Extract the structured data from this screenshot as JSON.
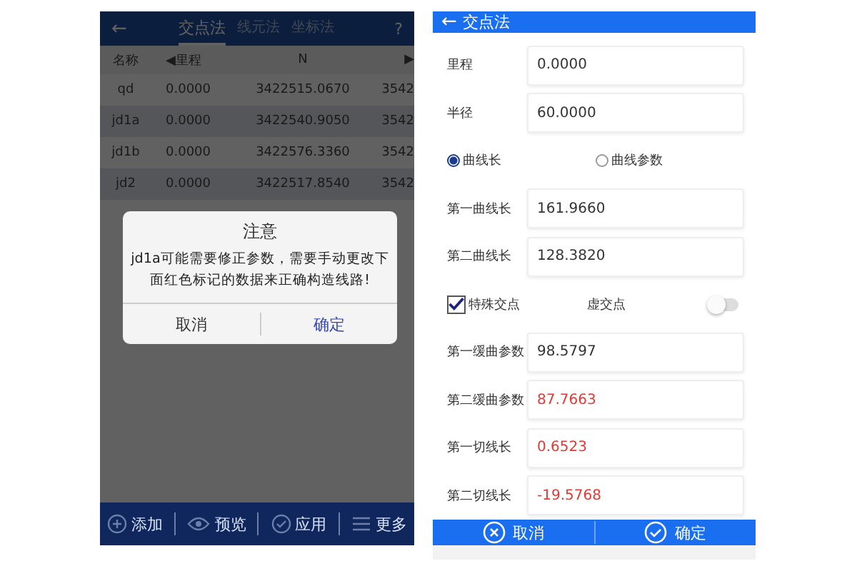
{
  "left_screen": {
    "header": {
      "back": "←",
      "tabs": [
        {
          "label": "交点法",
          "selected": true
        },
        {
          "label": "线元法",
          "selected": false
        },
        {
          "label": "坐标法",
          "selected": false
        }
      ],
      "help": "?"
    },
    "table": {
      "columns": [
        "名称",
        "◀里程",
        "N",
        "▶"
      ],
      "rows": [
        {
          "cells": [
            "qd",
            "0.0000",
            "3422515.0670",
            "3542"
          ]
        },
        {
          "cells": [
            "jd1a",
            "0.0000",
            "3422540.9050",
            "3542"
          ]
        },
        {
          "cells": [
            "jd1b",
            "0.0000",
            "3422576.3360",
            "3542"
          ]
        },
        {
          "cells": [
            "jd2",
            "0.0000",
            "3422517.8540",
            "3542"
          ]
        }
      ]
    },
    "dialog": {
      "title": "注意",
      "message": "jd1a可能需要修正参数，需要手动更改下面红色标记的数据来正确构造线路!",
      "buttons": [
        {
          "label": "取消",
          "kind": "cancel"
        },
        {
          "label": "确定",
          "kind": "confirm"
        }
      ]
    },
    "toolbar": [
      {
        "label": "添加",
        "kind": "add"
      },
      {
        "label": "预览",
        "kind": "eye"
      },
      {
        "label": "应用",
        "kind": "check"
      },
      {
        "label": "更多",
        "kind": "more"
      }
    ]
  },
  "right_screen": {
    "header": {
      "back": "←",
      "title": "交点法"
    },
    "rows": [
      {
        "kind": "field",
        "label": "里程",
        "value": "0.0000",
        "alert": false
      },
      {
        "kind": "field",
        "label": "半径",
        "value": "60.0000",
        "alert": false
      },
      {
        "kind": "radios",
        "options": [
          {
            "label": "曲线长",
            "selected": true
          },
          {
            "label": "曲线参数",
            "selected": false
          }
        ]
      },
      {
        "kind": "field",
        "label": "第一曲线长",
        "value": "161.9660",
        "alert": false
      },
      {
        "kind": "field",
        "label": "第二曲线长",
        "value": "128.3820",
        "alert": false
      },
      {
        "kind": "switches",
        "checkbox": {
          "label": "特殊交点",
          "checked": true
        },
        "toggle": {
          "label": "虚交点",
          "on": false
        }
      },
      {
        "kind": "field",
        "label": "第一缓曲参数",
        "value": "98.5797",
        "alert": false
      },
      {
        "kind": "field",
        "label": "第二缓曲参数",
        "value": "87.7663",
        "alert": true
      },
      {
        "kind": "field",
        "label": "第一切线长",
        "value": "0.6523",
        "alert": true
      },
      {
        "kind": "field",
        "label": "第二切线长",
        "value": "-19.5768",
        "alert": true
      }
    ],
    "buttons": [
      {
        "label": "取消",
        "kind": "cancel"
      },
      {
        "label": "确定",
        "kind": "confirm"
      }
    ]
  }
}
